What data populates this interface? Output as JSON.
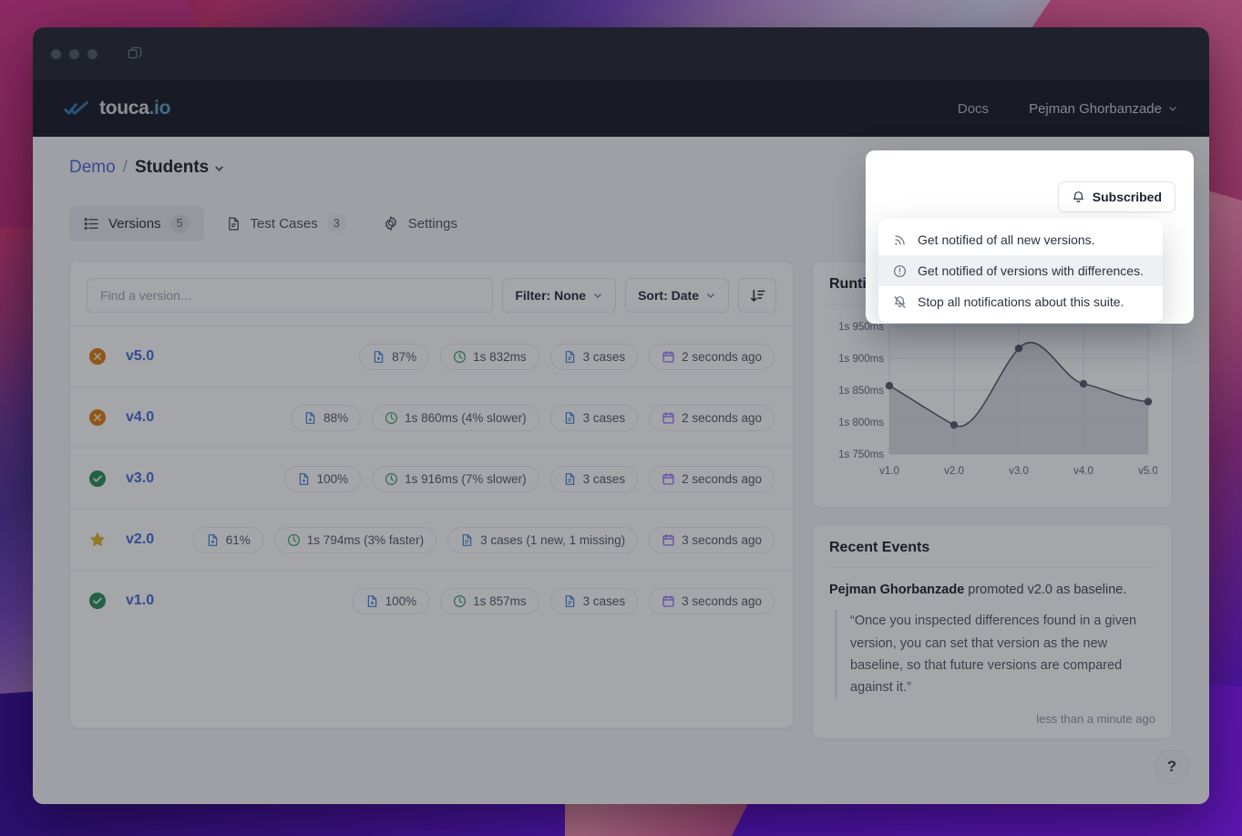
{
  "window": {
    "titlebar": {
      "dots": 3,
      "tabs_icon": "tabs-icon"
    }
  },
  "navbar": {
    "brand": "touca",
    "brand_suffix": ".io",
    "docs_label": "Docs",
    "user_name": "Pejman Ghorbanzade"
  },
  "breadcrumb": {
    "team": "Demo",
    "separator": "/",
    "suite": "Students"
  },
  "subscribe": {
    "label": "Subscribed",
    "icon": "bell-icon"
  },
  "tabs": [
    {
      "label": "Versions",
      "count": "5",
      "icon": "list-icon",
      "active": true
    },
    {
      "label": "Test Cases",
      "count": "3",
      "icon": "document-icon",
      "active": false
    },
    {
      "label": "Settings",
      "count": "",
      "icon": "gear-icon",
      "active": false
    }
  ],
  "toolbar": {
    "search_placeholder": "Find a version...",
    "search_value": "",
    "filter_label": "Filter: None",
    "sort_label": "Sort: Date",
    "order_icon": "sort-descending-icon"
  },
  "versions": [
    {
      "name": "v5.0",
      "status": "failed",
      "badges": [
        {
          "icon": "file-plus-icon",
          "color": "#3b7dd8",
          "text": "87%"
        },
        {
          "icon": "clock-icon",
          "color": "#2f9e5e",
          "text": "1s 832ms"
        },
        {
          "icon": "document-icon",
          "color": "#3b7dd8",
          "text": "3 cases"
        },
        {
          "icon": "calendar-icon",
          "color": "#8b5cf6",
          "text": "2 seconds ago"
        }
      ]
    },
    {
      "name": "v4.0",
      "status": "failed",
      "badges": [
        {
          "icon": "file-plus-icon",
          "color": "#3b7dd8",
          "text": "88%"
        },
        {
          "icon": "clock-icon",
          "color": "#2f9e5e",
          "text": "1s 860ms (4% slower)"
        },
        {
          "icon": "document-icon",
          "color": "#3b7dd8",
          "text": "3 cases"
        },
        {
          "icon": "calendar-icon",
          "color": "#8b5cf6",
          "text": "2 seconds ago"
        }
      ]
    },
    {
      "name": "v3.0",
      "status": "passed",
      "badges": [
        {
          "icon": "file-plus-icon",
          "color": "#3b7dd8",
          "text": "100%"
        },
        {
          "icon": "clock-icon",
          "color": "#2f9e5e",
          "text": "1s 916ms (7% slower)"
        },
        {
          "icon": "document-icon",
          "color": "#3b7dd8",
          "text": "3 cases"
        },
        {
          "icon": "calendar-icon",
          "color": "#8b5cf6",
          "text": "2 seconds ago"
        }
      ]
    },
    {
      "name": "v2.0",
      "status": "baseline",
      "badges": [
        {
          "icon": "file-plus-icon",
          "color": "#3b7dd8",
          "text": "61%"
        },
        {
          "icon": "clock-icon",
          "color": "#2f9e5e",
          "text": "1s 794ms (3% faster)"
        },
        {
          "icon": "document-icon",
          "color": "#3b7dd8",
          "text": "3 cases (1 new, 1 missing)"
        },
        {
          "icon": "calendar-icon",
          "color": "#8b5cf6",
          "text": "3 seconds ago"
        }
      ]
    },
    {
      "name": "v1.0",
      "status": "passed",
      "badges": [
        {
          "icon": "file-plus-icon",
          "color": "#3b7dd8",
          "text": "100%"
        },
        {
          "icon": "clock-icon",
          "color": "#2f9e5e",
          "text": "1s 857ms"
        },
        {
          "icon": "document-icon",
          "color": "#3b7dd8",
          "text": "3 cases"
        },
        {
          "icon": "calendar-icon",
          "color": "#8b5cf6",
          "text": "3 seconds ago"
        }
      ]
    }
  ],
  "runtime_panel": {
    "title": "Runtime"
  },
  "chart_data": {
    "type": "line",
    "title": "Runtime",
    "categories": [
      "v1.0",
      "v2.0",
      "v3.0",
      "v4.0",
      "v5.0"
    ],
    "values": [
      857,
      794,
      916,
      860,
      832
    ],
    "ytick_labels": [
      "1s 950ms",
      "1s 900ms",
      "1s 850ms",
      "1s 800ms",
      "1s 750ms"
    ],
    "yticks": [
      1950,
      1900,
      1850,
      1800,
      1750
    ],
    "value_offset_ms": 1000,
    "ylim": [
      1750,
      1950
    ],
    "xlabel": "",
    "ylabel": "",
    "grid": true,
    "legend": "none",
    "area_fill": true,
    "line_color": "#4c5566",
    "point_color": "#4c5566"
  },
  "events_panel": {
    "title": "Recent Events",
    "actor": "Pejman Ghorbanzade",
    "action": " promoted v2.0 as baseline.",
    "quote": "“Once you inspected differences found in a given version, you can set that version as the new baseline, so that future versions are compared against it.”",
    "time": "less than a minute ago"
  },
  "help": {
    "label": "?"
  },
  "notification_menu": {
    "items": [
      {
        "icon": "rss-icon",
        "label": "Get notified of all new versions.",
        "highlighted": false
      },
      {
        "icon": "exclamation-circle-icon",
        "label": "Get notified of versions with differences.",
        "highlighted": true
      },
      {
        "icon": "bell-slash-icon",
        "label": "Stop all notifications about this suite.",
        "highlighted": false
      }
    ]
  }
}
